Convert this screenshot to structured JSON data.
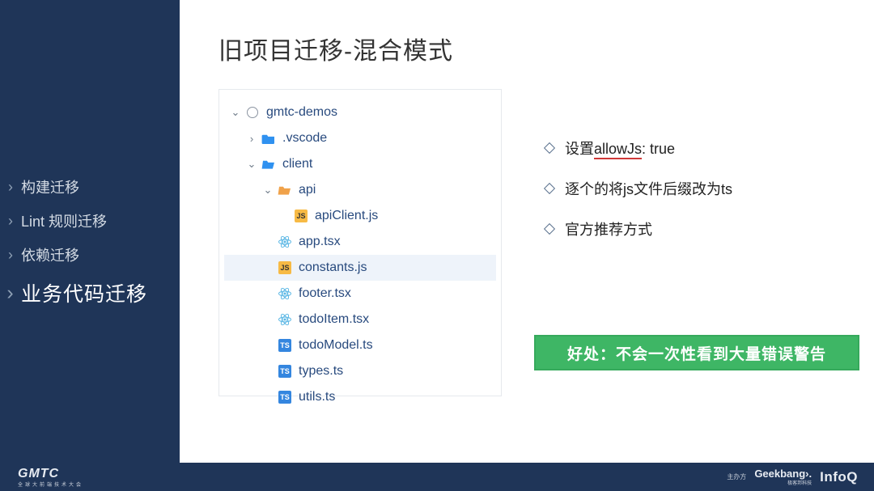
{
  "sidebar": {
    "items": [
      {
        "label": "构建迁移",
        "active": false
      },
      {
        "label": "Lint 规则迁移",
        "active": false
      },
      {
        "label": "依赖迁移",
        "active": false
      },
      {
        "label": "业务代码迁移",
        "active": true
      }
    ]
  },
  "footer": {
    "left_logo": "GMTC",
    "left_sub": "全球大前端技术大会",
    "host_label": "主办方",
    "geekbang": "Geekbang›.",
    "geekbang_sub": "极客邦科技",
    "infoq": "InfoQ"
  },
  "title": "旧项目迁移-混合模式",
  "tree": {
    "root": "gmtc-demos",
    "items": [
      {
        "name": ".vscode",
        "icon": "folder-blue",
        "expand": "closed",
        "depth": 2
      },
      {
        "name": "client",
        "icon": "folder-blue",
        "expand": "open",
        "depth": 2
      },
      {
        "name": "api",
        "icon": "folder-orange",
        "expand": "open",
        "depth": 3
      },
      {
        "name": "apiClient.js",
        "icon": "js",
        "depth": 4
      },
      {
        "name": "app.tsx",
        "icon": "react",
        "depth": 3
      },
      {
        "name": "constants.js",
        "icon": "js",
        "depth": 3,
        "selected": true
      },
      {
        "name": "footer.tsx",
        "icon": "react",
        "depth": 3
      },
      {
        "name": "todoItem.tsx",
        "icon": "react",
        "depth": 3
      },
      {
        "name": "todoModel.ts",
        "icon": "ts",
        "depth": 3
      },
      {
        "name": "types.ts",
        "icon": "ts",
        "depth": 3
      },
      {
        "name": "utils.ts",
        "icon": "ts",
        "depth": 3
      }
    ]
  },
  "bullets": [
    {
      "prefix": "设置",
      "underlined": "allowJs",
      "suffix": ": true"
    },
    {
      "prefix": "逐个的将js文件后缀改为ts",
      "underlined": "",
      "suffix": ""
    },
    {
      "prefix": "官方推荐方式",
      "underlined": "",
      "suffix": ""
    }
  ],
  "callout": "好处：不会一次性看到大量错误警告",
  "icons": {
    "js_text": "JS",
    "ts_text": "TS"
  }
}
